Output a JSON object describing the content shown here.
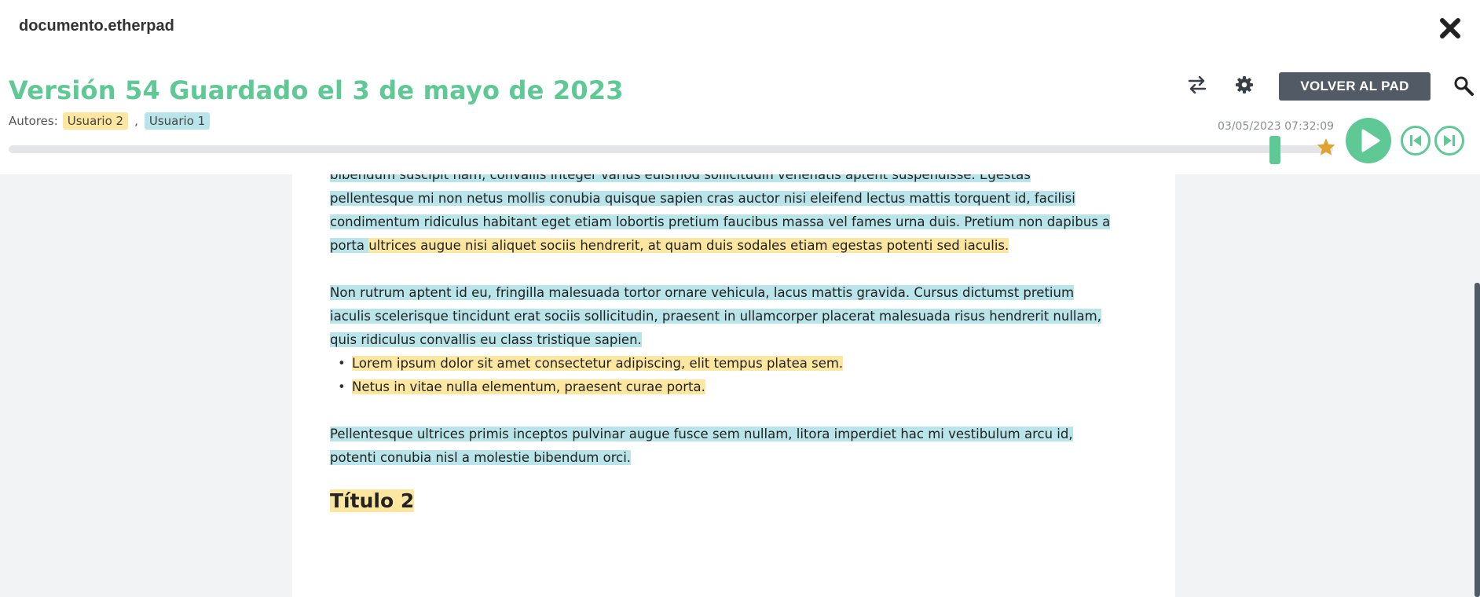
{
  "window": {
    "title": "documento.etherpad"
  },
  "header": {
    "version_title": "Versión 54 Guardado el 3 de mayo de 2023",
    "authors_label": "Autores:",
    "authors": [
      {
        "name": "Usuario 2",
        "color": "#fde7a0"
      },
      {
        "name": "Usuario 1",
        "color": "#b9e4ea"
      }
    ],
    "author_separator": ",",
    "return_button": "VOLVER AL PAD",
    "timestamp": "03/05/2023 07:32:09"
  },
  "timeslider": {
    "position": 0.956,
    "accent_color": "#5ec994",
    "star_color": "#e0a32e"
  },
  "document": {
    "para1": [
      {
        "text": "bibendum suscipit nam, convallis integer varius euismod sollicitudin venenatis aptent suspendisse. Egestas pellentesque mi non netus mollis conubia quisque sapien cras auctor nisi eleifend lectus mattis torquent id, facilisi condimentum ridiculus habitant eget etiam lobortis pretium faucibus massa vel fames urna duis. Pretium non dapibus a porta ",
        "author": "u1"
      },
      {
        "text": "ultrices augue nisi aliquet sociis hendrerit, at quam duis sodales etiam egestas potenti sed iaculis.",
        "author": "u2"
      }
    ],
    "para2": "Non rutrum aptent id eu, fringilla malesuada tortor ornare vehicula, lacus mattis gravida. Cursus dictumst pretium iaculis scelerisque tincidunt erat sociis sollicitudin, praesent in ullamcorper placerat malesuada risus hendrerit nullam, quis ridiculus convallis eu class tristique sapien.",
    "bullets": [
      "Lorem ipsum dolor sit amet consectetur adipiscing, elit tempus platea sem.",
      "Netus in vitae nulla elementum, praesent curae porta."
    ],
    "para3": "Pellentesque ultrices primis inceptos pulvinar augue fusce sem nullam, litora imperdiet hac mi vestibulum arcu id, potenti conubia nisl a molestie bibendum orci.",
    "heading2": "Título 2"
  },
  "icons": {
    "close": "close-icon",
    "compare": "swap-arrows-icon",
    "settings": "gear-icon",
    "search": "magnifier-icon",
    "star": "star-icon",
    "play": "play-icon",
    "step_back": "step-back-icon",
    "step_forward": "step-forward-icon"
  }
}
